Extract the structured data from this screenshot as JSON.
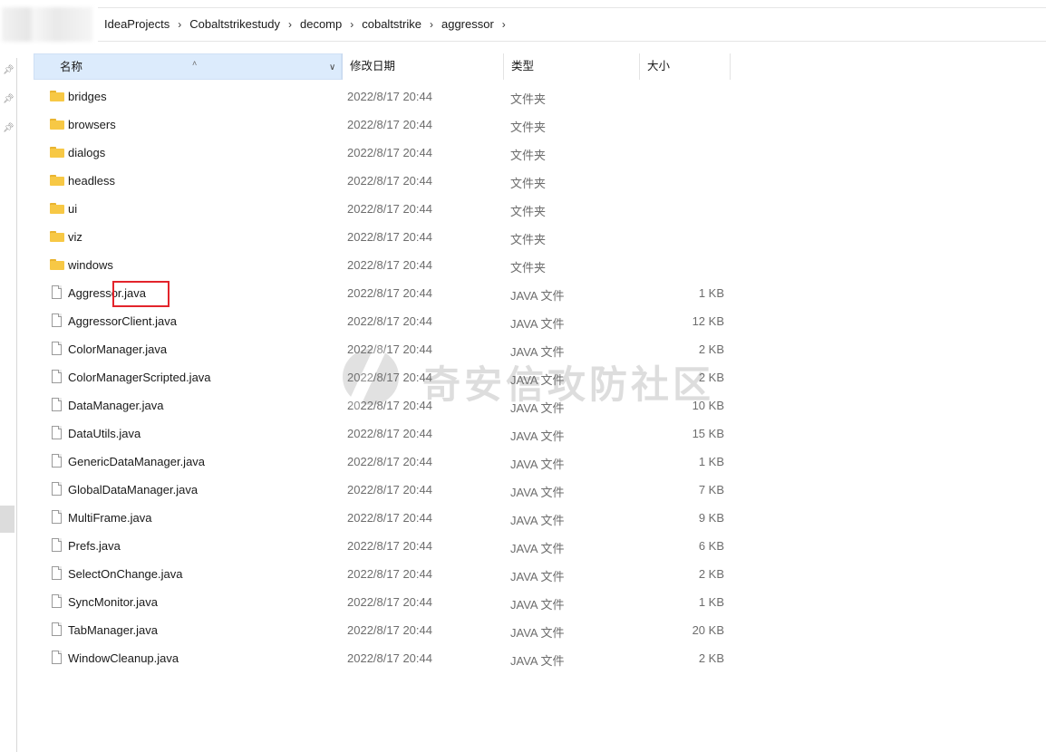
{
  "breadcrumb": [
    "IdeaProjects",
    "Cobaltstrikestudy",
    "decomp",
    "cobaltstrike",
    "aggressor"
  ],
  "columns": {
    "name": "名称",
    "date": "修改日期",
    "type": "类型",
    "size": "大小"
  },
  "files": [
    {
      "name": "bridges",
      "date": "2022/8/17 20:44",
      "type": "文件夹",
      "size": "",
      "icon": "folder-icon"
    },
    {
      "name": "browsers",
      "date": "2022/8/17 20:44",
      "type": "文件夹",
      "size": "",
      "icon": "folder-icon"
    },
    {
      "name": "dialogs",
      "date": "2022/8/17 20:44",
      "type": "文件夹",
      "size": "",
      "icon": "folder-icon"
    },
    {
      "name": "headless",
      "date": "2022/8/17 20:44",
      "type": "文件夹",
      "size": "",
      "icon": "folder-icon"
    },
    {
      "name": "ui",
      "date": "2022/8/17 20:44",
      "type": "文件夹",
      "size": "",
      "icon": "folder-icon"
    },
    {
      "name": "viz",
      "date": "2022/8/17 20:44",
      "type": "文件夹",
      "size": "",
      "icon": "folder-icon"
    },
    {
      "name": "windows",
      "date": "2022/8/17 20:44",
      "type": "文件夹",
      "size": "",
      "icon": "folder-icon"
    },
    {
      "name": "Aggressor.java",
      "date": "2022/8/17 20:44",
      "type": "JAVA 文件",
      "size": "1 KB",
      "icon": "file-icon"
    },
    {
      "name": "AggressorClient.java",
      "date": "2022/8/17 20:44",
      "type": "JAVA 文件",
      "size": "12 KB",
      "icon": "file-icon"
    },
    {
      "name": "ColorManager.java",
      "date": "2022/8/17 20:44",
      "type": "JAVA 文件",
      "size": "2 KB",
      "icon": "file-icon"
    },
    {
      "name": "ColorManagerScripted.java",
      "date": "2022/8/17 20:44",
      "type": "JAVA 文件",
      "size": "2 KB",
      "icon": "file-icon"
    },
    {
      "name": "DataManager.java",
      "date": "2022/8/17 20:44",
      "type": "JAVA 文件",
      "size": "10 KB",
      "icon": "file-icon"
    },
    {
      "name": "DataUtils.java",
      "date": "2022/8/17 20:44",
      "type": "JAVA 文件",
      "size": "15 KB",
      "icon": "file-icon"
    },
    {
      "name": "GenericDataManager.java",
      "date": "2022/8/17 20:44",
      "type": "JAVA 文件",
      "size": "1 KB",
      "icon": "file-icon"
    },
    {
      "name": "GlobalDataManager.java",
      "date": "2022/8/17 20:44",
      "type": "JAVA 文件",
      "size": "7 KB",
      "icon": "file-icon"
    },
    {
      "name": "MultiFrame.java",
      "date": "2022/8/17 20:44",
      "type": "JAVA 文件",
      "size": "9 KB",
      "icon": "file-icon"
    },
    {
      "name": "Prefs.java",
      "date": "2022/8/17 20:44",
      "type": "JAVA 文件",
      "size": "6 KB",
      "icon": "file-icon"
    },
    {
      "name": "SelectOnChange.java",
      "date": "2022/8/17 20:44",
      "type": "JAVA 文件",
      "size": "2 KB",
      "icon": "file-icon"
    },
    {
      "name": "SyncMonitor.java",
      "date": "2022/8/17 20:44",
      "type": "JAVA 文件",
      "size": "1 KB",
      "icon": "file-icon"
    },
    {
      "name": "TabManager.java",
      "date": "2022/8/17 20:44",
      "type": "JAVA 文件",
      "size": "20 KB",
      "icon": "file-icon"
    },
    {
      "name": "WindowCleanup.java",
      "date": "2022/8/17 20:44",
      "type": "JAVA 文件",
      "size": "2 KB",
      "icon": "file-icon"
    }
  ],
  "watermark": "奇安信攻防社区",
  "colors": {
    "header_selected": "#dcebfc",
    "folder": "#f7c845",
    "highlight": "#e3242b"
  }
}
